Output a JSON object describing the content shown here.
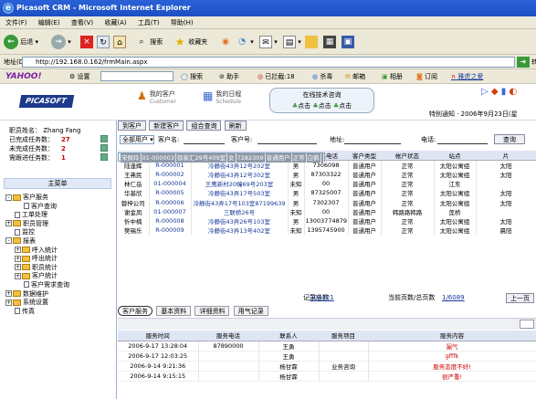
{
  "window": {
    "title": "Picasoft CRM - Microsoft Internet Explorer"
  },
  "menubar": [
    "文件(F)",
    "编辑(E)",
    "查看(V)",
    "收藏(A)",
    "工具(T)",
    "帮助(H)"
  ],
  "toolbar": {
    "back": "后退",
    "search": "搜索",
    "favorites": "收藏夹"
  },
  "address": {
    "label": "地址(D)",
    "url": "http://192.168.0.162/frmMain.aspx",
    "go": "转"
  },
  "yahoo_bar": {
    "logo": "YAHOO!",
    "settings": "设置",
    "search": "搜索",
    "assist": "助手",
    "blocked": "已拦截:18",
    "antivirus": "杀毒",
    "mail": "邮箱",
    "album": "相册",
    "subscribe": "订阅",
    "shop": "雅虎之爱"
  },
  "app_header": {
    "logo": "PICASOFT",
    "nav": [
      {
        "label": "我的客户",
        "sub": "Customer"
      },
      {
        "label": "我的日程",
        "sub": "Schedule"
      }
    ],
    "online": {
      "title": "在线技术咨询",
      "items": [
        "点击",
        "点击",
        "点击"
      ]
    },
    "date": "特别通知 · 2006年9月23日(星"
  },
  "left": {
    "user_label": "职员姓名：",
    "user_name": "Zhang Fang",
    "stats": [
      {
        "label": "已完成任务数：",
        "value": "27"
      },
      {
        "label": "未完成任务数：",
        "value": "2"
      },
      {
        "label": "需跟进任务数：",
        "value": "1"
      }
    ],
    "menu_title": "主菜单",
    "tree": [
      {
        "label": "客户服务",
        "type": "folder",
        "pm": "-",
        "indent": 0
      },
      {
        "label": "客户查询",
        "type": "doc",
        "indent": 2
      },
      {
        "label": "工单处理",
        "type": "doc",
        "indent": 1
      },
      {
        "label": "职员管理",
        "type": "folder",
        "pm": "+",
        "indent": 0
      },
      {
        "label": "监控",
        "type": "doc",
        "indent": 1
      },
      {
        "label": "报表",
        "type": "folder",
        "pm": "-",
        "indent": 0
      },
      {
        "label": "呼入统计",
        "type": "folder",
        "pm": "+",
        "indent": 1
      },
      {
        "label": "呼出统计",
        "type": "folder",
        "pm": "+",
        "indent": 1
      },
      {
        "label": "职员统计",
        "type": "folder",
        "pm": "+",
        "indent": 1
      },
      {
        "label": "客户统计",
        "type": "folder",
        "pm": "+",
        "indent": 1
      },
      {
        "label": "客户需求查询",
        "type": "doc",
        "indent": 2
      },
      {
        "label": "数据维护",
        "type": "folder",
        "pm": "+",
        "indent": 0
      },
      {
        "label": "系统设置",
        "type": "folder",
        "pm": "+",
        "indent": 0
      },
      {
        "label": "传真",
        "type": "doc",
        "indent": 1
      }
    ]
  },
  "content": {
    "buttons": [
      "到客户",
      "新建客户",
      "组合查询",
      "刷新"
    ],
    "filter": {
      "select": "全部用户",
      "name_label": "客户名:",
      "number_label": "客户号:",
      "address_label": "地址:",
      "phone_label": "电话:",
      "query": "查询"
    },
    "columns": [
      "客户名",
      "客户编号",
      "地址",
      "性别",
      "联系电话",
      "客户类型",
      "帐户状态",
      "站点",
      "片"
    ],
    "rows": [
      [
        "陆逢辉",
        "R-000001",
        "冷静街43弄12号202室",
        "男",
        "7306098",
        "普通用户",
        "正常",
        "太阳公寓组",
        "太阳"
      ],
      [
        "王弗民",
        "R-000002",
        "冷静街43弄12号302室",
        "男",
        "87303322",
        "普通用户",
        "正常",
        "太阳公寓组",
        "太阳"
      ],
      [
        "宋佩玲",
        "01-000003",
        "徐家汇29号409室",
        "女",
        "7282309",
        "普通用户",
        "正常",
        "白鹤",
        ""
      ],
      [
        "林仁岳",
        "01-000004",
        "王鹰新村20幢69号203室",
        "未知",
        "00",
        "普通用户",
        "正常",
        "江东",
        ""
      ],
      [
        "华基欣",
        "R-000005",
        "冷静街43弄17号503室",
        "男",
        "87325007",
        "普通用户",
        "正常",
        "太阳公寓组",
        "太阳"
      ],
      [
        "蓉梓公司",
        "R-000006",
        "冷静街43弄17号103室87199639",
        "男",
        "7302307",
        "普通用户",
        "正常",
        "太阳公寓组",
        "太阳"
      ],
      [
        "谢金凤",
        "01-000007",
        "三联桥26号",
        "未知",
        "00",
        "普通用户",
        "韩路路韩路",
        "莲桥",
        ""
      ],
      [
        "忻中楠",
        "R-000008",
        "冷静街43弄26号103室",
        "男",
        "13003774879",
        "普通用户",
        "正常",
        "太阳公寓组",
        "太阳"
      ],
      [
        "樊锡乐",
        "R-000009",
        "冷静街43弄13号402室",
        "未知",
        "1395745900",
        "普通用户",
        "正常",
        "太阳公寓组",
        "晨阳"
      ]
    ],
    "selected_row": 2,
    "pager": {
      "total_label": "记录总数",
      "total": "304421",
      "page_label": "当前页数/总页数",
      "page": "1/6089",
      "prev": "上一页"
    },
    "tabs": [
      "客户服务",
      "基本资料",
      "详细资料",
      "用气记录"
    ],
    "service_columns": [
      "服务时间",
      "服务电话",
      "联系人",
      "服务项目",
      "服务内容"
    ],
    "service_rows": [
      [
        "2006-9-17 13:28:04",
        "87890000",
        "王勇",
        "",
        "漏气"
      ],
      [
        "2006-9-17 12:03:25",
        "",
        "王勇",
        "",
        "gfffk"
      ],
      [
        "2006-9-14 9:21:36",
        "",
        "杨甘霖",
        "业务咨询",
        "服务态度不好!"
      ],
      [
        "2006-9-14 9:15:15",
        "",
        "杨甘霖",
        "",
        "很严重!"
      ]
    ]
  }
}
